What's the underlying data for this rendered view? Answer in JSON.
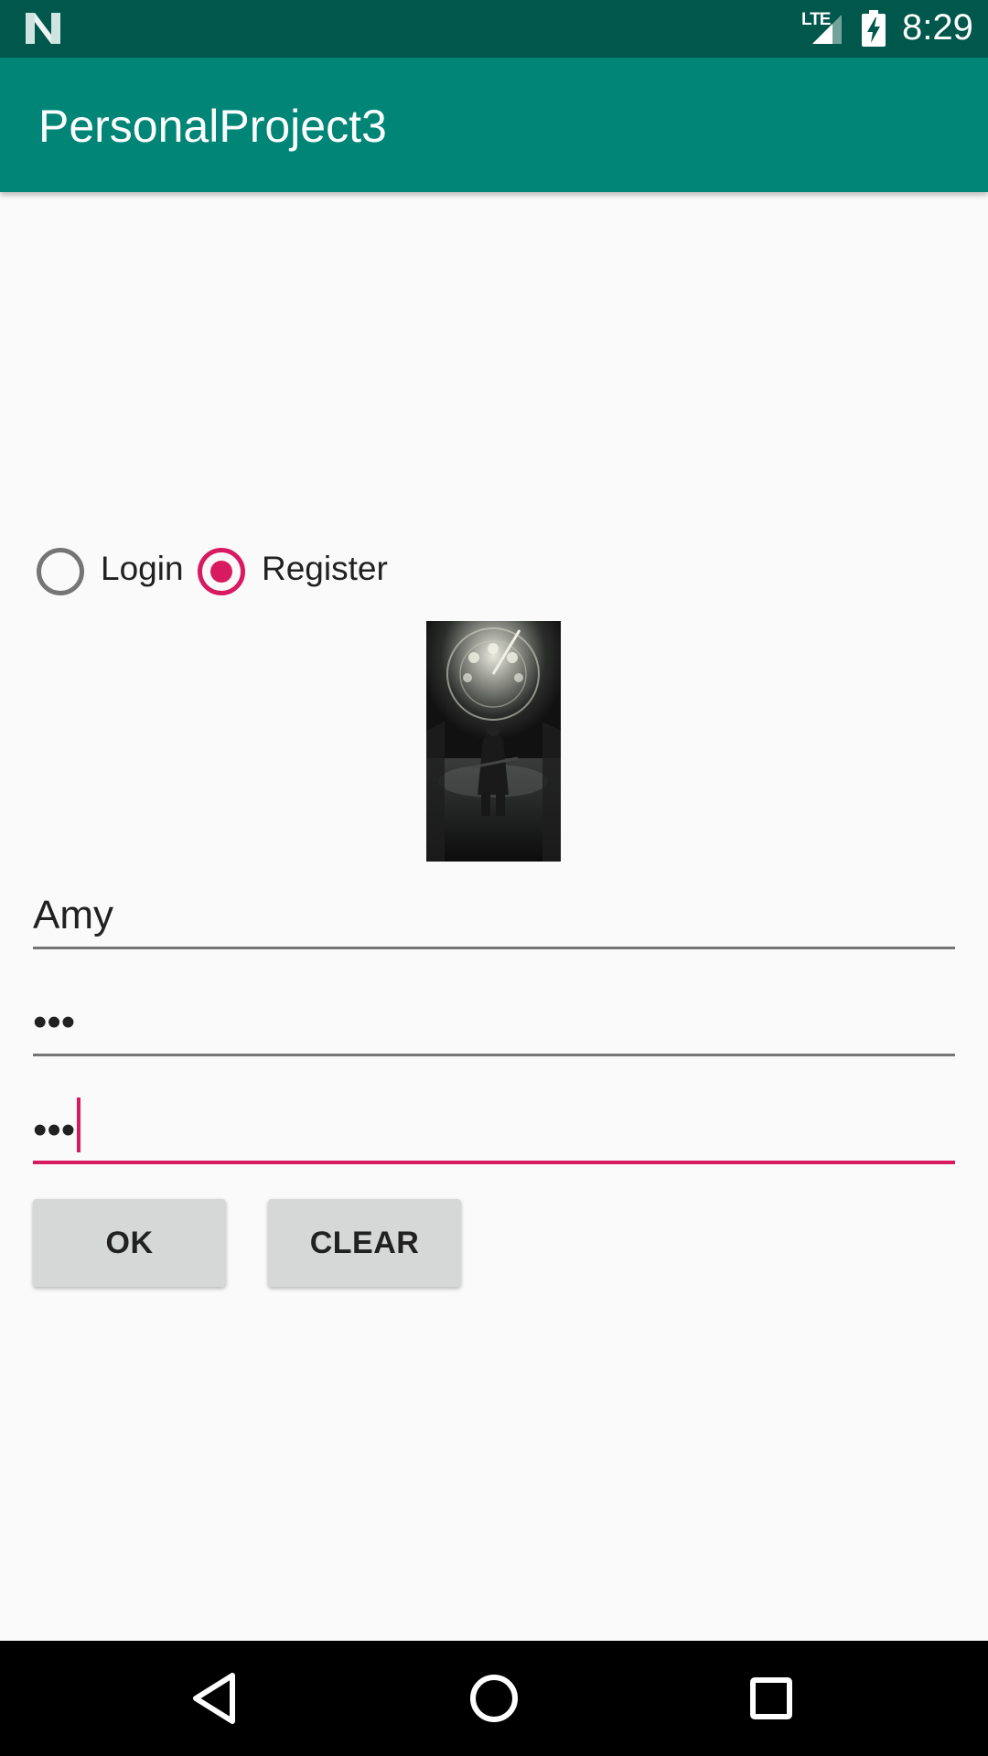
{
  "status_bar": {
    "network_type": "LTE",
    "time": "8:29",
    "icons": [
      "notification-n-icon",
      "lte-signal-icon",
      "battery-charging-icon"
    ]
  },
  "app_bar": {
    "title": "PersonalProject3"
  },
  "mode_selector": {
    "options": [
      {
        "label": "Login",
        "checked": false
      },
      {
        "label": "Register",
        "checked": true
      }
    ]
  },
  "form": {
    "username": {
      "value": "Amy"
    },
    "password": {
      "value": "•••"
    },
    "confirm_password": {
      "value": "•••"
    }
  },
  "buttons": {
    "ok_label": "OK",
    "clear_label": "CLEAR"
  },
  "navigation": {
    "icons": [
      "back-icon",
      "home-icon",
      "recents-icon"
    ]
  },
  "colors": {
    "status_bar": "#00574b",
    "app_bar": "#008577",
    "accent": "#d81b60",
    "button": "#d6d7d7",
    "background": "#fafafa"
  }
}
